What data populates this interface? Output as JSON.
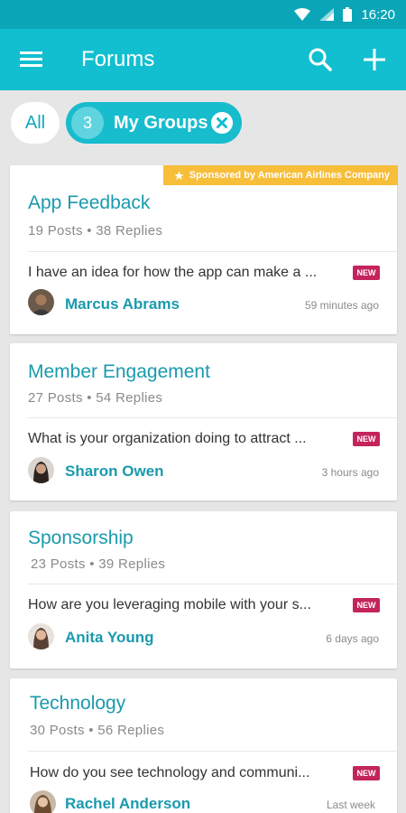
{
  "status_bar": {
    "time": "16:20"
  },
  "app_bar": {
    "title": "Forums"
  },
  "filters": {
    "all_label": "All",
    "groups_count": "3",
    "groups_label": "My Groups"
  },
  "cards": [
    {
      "name": "App Feedback",
      "posts": "19 Posts",
      "replies": "38 Replies",
      "snippet": "I have an idea for how the app can make a ...",
      "badge": "NEW",
      "author": "Marcus Abrams",
      "time": "59 minutes ago",
      "sponsor": "Sponsored by American Airlines Company"
    },
    {
      "name": "Member Engagement",
      "posts": "27 Posts",
      "replies": "54 Replies",
      "snippet": "What is your organization doing to attract ...",
      "badge": "NEW",
      "author": "Sharon Owen",
      "time": "3 hours ago"
    },
    {
      "name": "Sponsorship",
      "posts": "23 Posts",
      "replies": "39 Replies",
      "snippet": "How are you leveraging mobile with your s...",
      "badge": "NEW",
      "author": "Anita Young",
      "time": "6 days ago"
    },
    {
      "name": "Technology",
      "posts": "30 Posts",
      "replies": "56 Replies",
      "snippet": "How do you see technology and communi...",
      "badge": "NEW",
      "author": "Rachel Anderson",
      "time": "Last week"
    }
  ],
  "colors": {
    "primary": "#12bfd0",
    "status_bar": "#0aa6b8",
    "accent_text": "#1a9aad",
    "new_badge": "#c4245c",
    "sponsor": "#f7be3a"
  },
  "icons": [
    "wifi-icon",
    "signal-icon",
    "battery-icon",
    "menu-icon",
    "search-icon",
    "add-icon",
    "clear-icon",
    "star-icon"
  ]
}
